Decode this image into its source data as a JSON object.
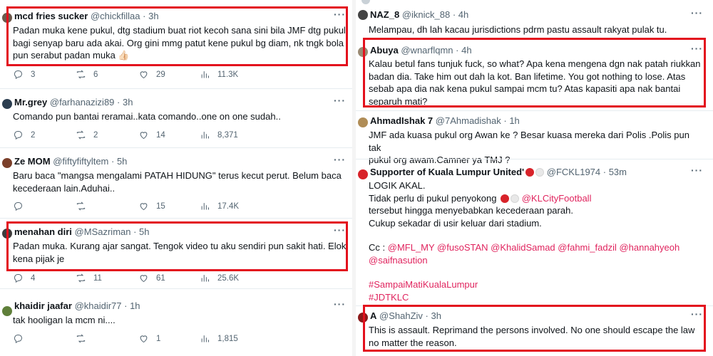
{
  "left": {
    "tweets": [
      {
        "name": "mcd fries sucker",
        "handle": "@chickfillaa",
        "time": "· 3h",
        "text": "Padan muka kene pukul, dtg stadium buat riot kecoh sana sini bila JMF dtg pukul\nbagi senyap baru ada akai. Org gini mmg patut kene pukul bg diam, nk tngk bola\npun serabut padan muka 👍🏻",
        "replies": "3",
        "retweets": "6",
        "likes": "29",
        "views": "11.3K"
      },
      {
        "name": "Mr.grey",
        "handle": "@farhanazizi89",
        "time": "· 3h",
        "text": "Comando pun bantai reramai..kata comando..one on one sudah..",
        "replies": "2",
        "retweets": "2",
        "likes": "14",
        "views": "8,371"
      },
      {
        "name": "Ze MOM",
        "handle": "@fiftyfiftyltem",
        "time": "· 5h",
        "text": "Baru baca \"mangsa mengalami PATAH HIDUNG\" terus kecut perut. Belum baca\nkecederaan lain.Aduhai..",
        "replies": "",
        "retweets": "",
        "likes": "15",
        "views": "17.4K"
      },
      {
        "name": "menahan diri",
        "handle": "@MSazriman",
        "time": "· 5h",
        "text": "Padan muka. Kurang ajar sangat. Tengok video tu aku sendiri pun sakit hati. Elok\nkena pijak je",
        "replies": "4",
        "retweets": "11",
        "likes": "61",
        "views": "25.6K"
      },
      {
        "name": "khaidir jaafar",
        "handle": "@khaidir77",
        "time": "· 1h",
        "text": "tak hooligan la mcm ni....",
        "replies": "",
        "retweets": "",
        "likes": "1",
        "views": "1,815"
      }
    ]
  },
  "right": {
    "tweets": [
      {
        "name": "NAZ_8",
        "handle": "@iknick_88",
        "time": "· 4h",
        "text": "Melampau, dh lah kacau jurisdictions pdrm pastu assault rakyat pulak tu."
      },
      {
        "name": "Abuya",
        "handle": "@wnarflqmn",
        "time": "· 4h",
        "text": "Kalau betul fans tunjuk fuck, so what? Apa kena mengena dgn nak patah riukkan\nbadan dia. Take him out dah la kot. Ban lifetime. You got nothing to lose. Atas\nsebab apa dia nak kena pukul sampai mcm tu? Atas kapasiti apa nak bantai\nseparuh mati?"
      },
      {
        "name": "AhmadIshak 7",
        "handle": "@7Ahmadishak",
        "time": "· 1h",
        "text": "JMF ada kuasa pukul org Awan ke ? Besar kuasa mereka dari Polis .Polis pun tak\npukul org awam.Camner ya TMJ ?"
      },
      {
        "name": "Supporter of Kuala Lumpur United'",
        "handle": "@FCKL1974",
        "time": "· 53m",
        "line1": "LOGIK AKAL.",
        "line2a": "Tidak perlu di pukul penyokong",
        "line2b": "@KLCityFootball",
        "line3": "tersebut hingga menyebabkan kecederaan parah.",
        "line4": "Cukup sekadar di usir keluar dari stadium.",
        "cc_label": "Cc :",
        "cc_mentions_1": "@MFL_MY @fusoSTAN @KhalidSamad @fahmi_fadzil @hannahyeoh",
        "cc_mentions_2": "@saifnasution",
        "hashtag1": "#SampaiMatiKualaLumpur",
        "hashtag2": "#JDTKLC"
      },
      {
        "name": "A",
        "handle": "@ShahZiv",
        "time": "· 3h",
        "text": "This is assault. Reprimand the persons involved. No one should escape the law\nno matter the reason."
      }
    ]
  },
  "more_label": "···",
  "colors": {
    "highlight": "#e3101d",
    "link": "#e0245e",
    "muted": "#536471",
    "text": "#0f1419"
  },
  "icons": [
    "reply-icon",
    "retweet-icon",
    "like-icon",
    "views-icon",
    "more-icon"
  ]
}
